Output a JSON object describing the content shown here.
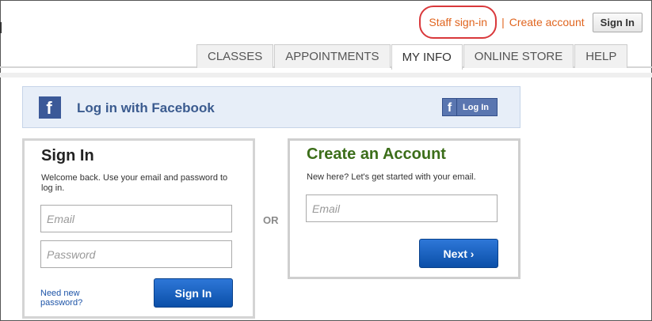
{
  "header": {
    "staff_signin": "Staff sign-in",
    "create_account": "Create account",
    "signin_button": "Sign In"
  },
  "tabs": [
    {
      "label": "CLASSES"
    },
    {
      "label": "APPOINTMENTS"
    },
    {
      "label": "MY INFO"
    },
    {
      "label": "ONLINE STORE"
    },
    {
      "label": "HELP"
    }
  ],
  "active_tab": "MY INFO",
  "facebook": {
    "text": "Log in with Facebook",
    "button_icon": "f",
    "button_label": "Log In",
    "logo_icon": "f"
  },
  "signin_panel": {
    "title": "Sign In",
    "description": "Welcome back. Use your email and password to log in.",
    "email_placeholder": "Email",
    "password_placeholder": "Password",
    "forgot_link": "Need new password?",
    "submit_label": "Sign In"
  },
  "or_label": "OR",
  "create_panel": {
    "title": "Create an Account",
    "description": "New here? Let's get started with your email.",
    "email_placeholder": "Email",
    "next_label": "Next ›"
  },
  "colors": {
    "link_orange": "#e0651f",
    "highlight_red": "#d9383b",
    "facebook_blue": "#3b5998",
    "button_blue": "#0b4fa8",
    "create_title_green": "#3c6e1a"
  }
}
